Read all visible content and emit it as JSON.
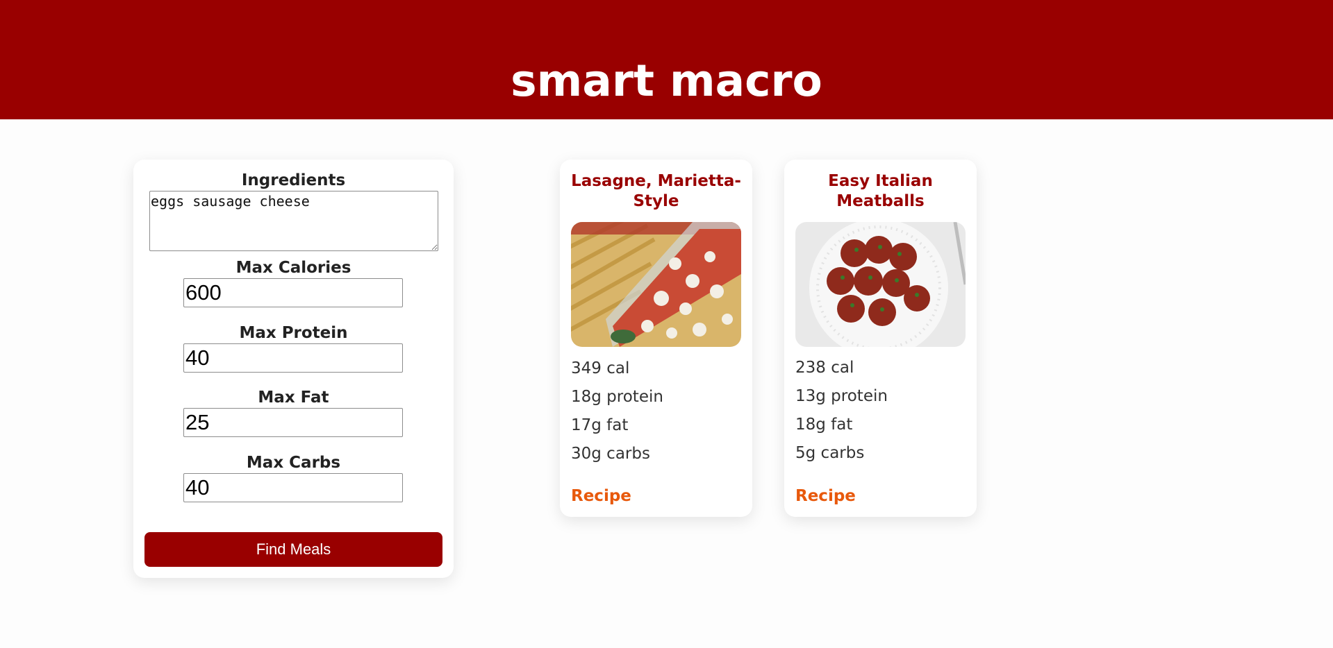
{
  "header": {
    "title": "smart macro"
  },
  "form": {
    "ingredients_label": "Ingredients",
    "ingredients_value": "eggs sausage cheese",
    "max_calories_label": "Max Calories",
    "max_calories_value": "600",
    "max_protein_label": "Max Protein",
    "max_protein_value": "40",
    "max_fat_label": "Max Fat",
    "max_fat_value": "25",
    "max_carbs_label": "Max Carbs",
    "max_carbs_value": "40",
    "submit_label": "Find Meals"
  },
  "results": [
    {
      "title": "Lasagne, Marietta-Style",
      "image_icon": "lasagna-photo",
      "calories": "349 cal",
      "protein": "18g protein",
      "fat": "17g fat",
      "carbs": "30g carbs",
      "link_label": "Recipe"
    },
    {
      "title": "Easy Italian Meatballs",
      "image_icon": "meatballs-photo",
      "calories": "238 cal",
      "protein": "13g protein",
      "fat": "18g fat",
      "carbs": "5g carbs",
      "link_label": "Recipe"
    }
  ],
  "colors": {
    "brand": "#990000",
    "link": "#e8590c",
    "background": "#fdfdfd"
  }
}
